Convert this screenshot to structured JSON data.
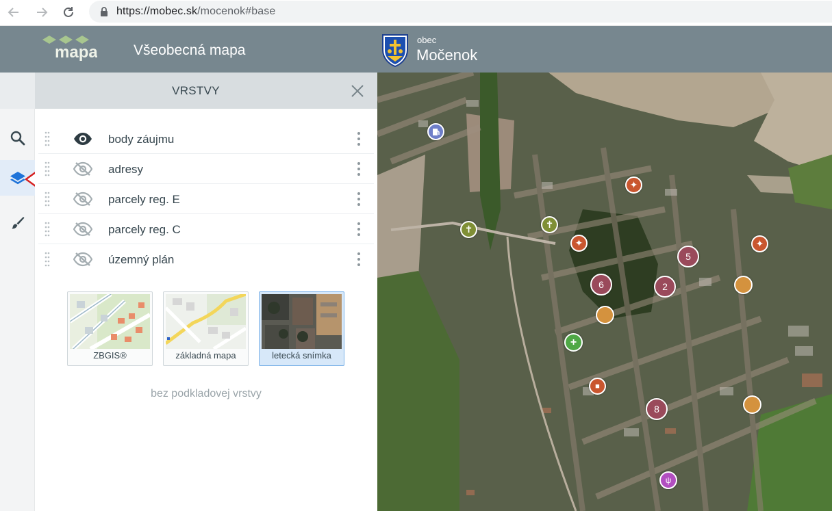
{
  "browser": {
    "url_host": "https://mobec.sk",
    "url_path": "/mocenok#base"
  },
  "header": {
    "logo_text": "mapa",
    "app_title": "Všeobecná mapa",
    "municipality_prefix": "obec",
    "municipality_name": "Močenok"
  },
  "rail": {
    "items": [
      {
        "icon": "search-icon"
      },
      {
        "icon": "layers-icon",
        "active": true
      },
      {
        "icon": "brush-icon"
      }
    ]
  },
  "panel": {
    "title": "VRSTVY",
    "layers": [
      {
        "label": "body záujmu",
        "visible": true
      },
      {
        "label": "adresy",
        "visible": false
      },
      {
        "label": "parcely reg. E",
        "visible": false
      },
      {
        "label": "parcely reg. C",
        "visible": false
      },
      {
        "label": "územný plán",
        "visible": false
      }
    ],
    "basemaps": [
      {
        "label": "ZBGIS®",
        "active": false
      },
      {
        "label": "základná mapa",
        "active": false
      },
      {
        "label": "letecká snímka",
        "active": true
      }
    ],
    "no_basemap_label": "bez podkladovej vrstvy"
  },
  "map": {
    "markers": [
      {
        "kind": "fuel",
        "color": "#6f7fc9"
      },
      {
        "kind": "sport",
        "color": "#c9562f"
      },
      {
        "kind": "cemetery",
        "color": "#7f8f35"
      },
      {
        "kind": "cemetery",
        "color": "#7f8f35"
      },
      {
        "kind": "sport",
        "color": "#c9562f"
      },
      {
        "kind": "sport",
        "color": "#c9562f"
      },
      {
        "kind": "cluster",
        "count": "5",
        "color": "#9a4a5b"
      },
      {
        "kind": "cluster",
        "count": "6",
        "color": "#9a4a5b"
      },
      {
        "kind": "cluster",
        "count": "2",
        "color": "#9a4a5b"
      },
      {
        "kind": "poi",
        "color": "#d4923e"
      },
      {
        "kind": "poi",
        "color": "#d4923e"
      },
      {
        "kind": "pharmacy",
        "color": "#4fa845"
      },
      {
        "kind": "service",
        "color": "#c9562f"
      },
      {
        "kind": "cluster",
        "count": "8",
        "color": "#9a4a5b"
      },
      {
        "kind": "poi",
        "color": "#d4923e"
      },
      {
        "kind": "restaurant",
        "color": "#b24fc0"
      }
    ]
  }
}
